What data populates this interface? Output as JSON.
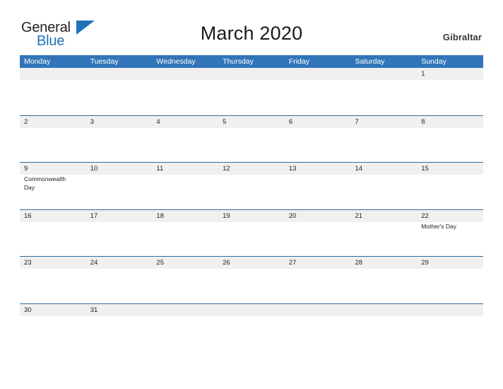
{
  "brand": {
    "word_one": "General",
    "word_two": "Blue",
    "color_dark": "#231f20",
    "color_blue": "#2173b8"
  },
  "header": {
    "title": "March 2020",
    "region": "Gibraltar"
  },
  "theme": {
    "header_blue": "#3275b8",
    "row_line": "#2e6da4",
    "band_gray": "#f0f0f0",
    "page_background": "#ffffff"
  },
  "calendar": {
    "month": "March",
    "year": "2020",
    "week_start": "Monday",
    "weekdays": [
      "Monday",
      "Tuesday",
      "Wednesday",
      "Thursday",
      "Friday",
      "Saturday",
      "Sunday"
    ],
    "weeks": [
      [
        {
          "num": "",
          "events": []
        },
        {
          "num": "",
          "events": []
        },
        {
          "num": "",
          "events": []
        },
        {
          "num": "",
          "events": []
        },
        {
          "num": "",
          "events": []
        },
        {
          "num": "",
          "events": []
        },
        {
          "num": "1",
          "events": []
        }
      ],
      [
        {
          "num": "2",
          "events": []
        },
        {
          "num": "3",
          "events": []
        },
        {
          "num": "4",
          "events": []
        },
        {
          "num": "5",
          "events": []
        },
        {
          "num": "6",
          "events": []
        },
        {
          "num": "7",
          "events": []
        },
        {
          "num": "8",
          "events": []
        }
      ],
      [
        {
          "num": "9",
          "events": [
            "Commonwealth Day"
          ]
        },
        {
          "num": "10",
          "events": []
        },
        {
          "num": "11",
          "events": []
        },
        {
          "num": "12",
          "events": []
        },
        {
          "num": "13",
          "events": []
        },
        {
          "num": "14",
          "events": []
        },
        {
          "num": "15",
          "events": []
        }
      ],
      [
        {
          "num": "16",
          "events": []
        },
        {
          "num": "17",
          "events": []
        },
        {
          "num": "18",
          "events": []
        },
        {
          "num": "19",
          "events": []
        },
        {
          "num": "20",
          "events": []
        },
        {
          "num": "21",
          "events": []
        },
        {
          "num": "22",
          "events": [
            "Mother's Day"
          ]
        }
      ],
      [
        {
          "num": "23",
          "events": []
        },
        {
          "num": "24",
          "events": []
        },
        {
          "num": "25",
          "events": []
        },
        {
          "num": "26",
          "events": []
        },
        {
          "num": "27",
          "events": []
        },
        {
          "num": "28",
          "events": []
        },
        {
          "num": "29",
          "events": []
        }
      ],
      [
        {
          "num": "30",
          "events": []
        },
        {
          "num": "31",
          "events": []
        },
        {
          "num": "",
          "events": []
        },
        {
          "num": "",
          "events": []
        },
        {
          "num": "",
          "events": []
        },
        {
          "num": "",
          "events": []
        },
        {
          "num": "",
          "events": []
        }
      ]
    ]
  }
}
